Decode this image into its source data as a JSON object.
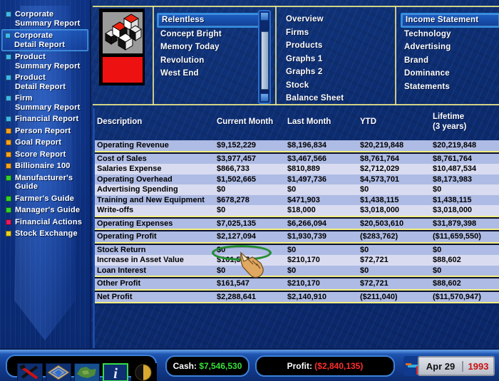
{
  "sidebar": {
    "items": [
      {
        "label": [
          "Corporate",
          "Summary Report"
        ],
        "color": "#3fb6ea",
        "selected": false
      },
      {
        "label": [
          "Corporate",
          "Detail Report"
        ],
        "color": "#3fb6ea",
        "selected": true
      },
      {
        "label": [
          "Product",
          "Summary Report"
        ],
        "color": "#3fb6ea",
        "selected": false
      },
      {
        "label": [
          "Product",
          "Detail Report"
        ],
        "color": "#3fb6ea",
        "selected": false
      },
      {
        "label": [
          "Firm",
          "Summary Report"
        ],
        "color": "#3fb6ea",
        "selected": false
      },
      {
        "label": [
          "Financial Report"
        ],
        "color": "#3fb6ea",
        "selected": false
      },
      {
        "label": [
          "Person Report"
        ],
        "color": "#f5a21e",
        "selected": false
      },
      {
        "label": [
          "Goal Report"
        ],
        "color": "#f5a21e",
        "selected": false
      },
      {
        "label": [
          "Score Report"
        ],
        "color": "#f5a21e",
        "selected": false
      },
      {
        "label": [
          "Billionaire 100"
        ],
        "color": "#f5a21e",
        "selected": false
      },
      {
        "label": [
          "Manufacturer's",
          "Guide"
        ],
        "color": "#34d12a",
        "selected": false
      },
      {
        "label": [
          "Farmer's Guide"
        ],
        "color": "#34d12a",
        "selected": false
      },
      {
        "label": [
          "Manager's Guide"
        ],
        "color": "#34d12a",
        "selected": false
      },
      {
        "label": [
          "Financial Actions"
        ],
        "color": "#e81a5e",
        "selected": false
      },
      {
        "label": [
          "Stock Exchange"
        ],
        "color": "#e8d21e",
        "selected": false
      }
    ]
  },
  "logo": {
    "name": "company-logo"
  },
  "firm_list": {
    "items": [
      {
        "label": "Relentless",
        "selected": true
      },
      {
        "label": "Concept Bright",
        "selected": false
      },
      {
        "label": "Memory Today",
        "selected": false
      },
      {
        "label": "Revolution",
        "selected": false
      },
      {
        "label": "West End",
        "selected": false
      }
    ]
  },
  "section_menu": {
    "items": [
      {
        "label": "Overview",
        "selected": false
      },
      {
        "label": "Firms",
        "selected": false
      },
      {
        "label": "Products",
        "selected": false
      },
      {
        "label": "Graphs 1",
        "selected": false
      },
      {
        "label": "Graphs 2",
        "selected": false
      },
      {
        "label": "Stock",
        "selected": false
      },
      {
        "label": "Balance Sheet",
        "selected": false
      }
    ]
  },
  "detail_menu": {
    "items": [
      {
        "label": "Income Statement",
        "selected": true
      },
      {
        "label": "Technology",
        "selected": false
      },
      {
        "label": "Advertising",
        "selected": false
      },
      {
        "label": "Brand",
        "selected": false
      },
      {
        "label": "Dominance",
        "selected": false
      },
      {
        "label": "Statements",
        "selected": false
      }
    ]
  },
  "table": {
    "headers": [
      "Description",
      "Current Month",
      "Last Month",
      "YTD",
      "Lifetime"
    ],
    "header_sub": "(3 years)",
    "groups": [
      {
        "rows": [
          {
            "desc": "Operating Revenue",
            "current": "$9,152,229",
            "last": "$8,196,834",
            "ytd": "$20,219,848",
            "lifetime": "$20,219,848"
          }
        ]
      },
      {
        "rows": [
          {
            "desc": "Cost of Sales",
            "current": "$3,977,457",
            "last": "$3,467,566",
            "ytd": "$8,761,764",
            "lifetime": "$8,761,764"
          },
          {
            "desc": "Salaries Expense",
            "current": "$866,733",
            "last": "$810,889",
            "ytd": "$2,712,029",
            "lifetime": "$10,487,534"
          },
          {
            "desc": "Operating Overhead",
            "current": "$1,502,665",
            "last": "$1,497,736",
            "ytd": "$4,573,701",
            "lifetime": "$8,173,983"
          },
          {
            "desc": "Advertising Spending",
            "current": "$0",
            "last": "$0",
            "ytd": "$0",
            "lifetime": "$0"
          },
          {
            "desc": "Training and New Equipment",
            "current": "$678,278",
            "last": "$471,903",
            "ytd": "$1,438,115",
            "lifetime": "$1,438,115"
          },
          {
            "desc": "Write-offs",
            "current": "$0",
            "last": "$18,000",
            "ytd": "$3,018,000",
            "lifetime": "$3,018,000"
          }
        ]
      },
      {
        "rows": [
          {
            "desc": "Operating Expenses",
            "current": "$7,025,135",
            "last": "$6,266,094",
            "ytd": "$20,503,610",
            "lifetime": "$31,879,398"
          }
        ]
      },
      {
        "rows": [
          {
            "desc": "Operating Profit",
            "current": "$2,127,094",
            "last": "$1,930,739",
            "ytd": "($283,762)",
            "lifetime": "($11,659,550)"
          }
        ]
      },
      {
        "rows": [
          {
            "desc": "Stock Return",
            "current": "$0",
            "last": "$0",
            "ytd": "$0",
            "lifetime": "$0"
          },
          {
            "desc": "Increase in Asset Value",
            "current": "$161,547",
            "last": "$210,170",
            "ytd": "$72,721",
            "lifetime": "$88,602"
          },
          {
            "desc": "Loan Interest",
            "current": "$0",
            "last": "$0",
            "ytd": "$0",
            "lifetime": "$0"
          }
        ]
      },
      {
        "rows": [
          {
            "desc": "Other Profit",
            "current": "$161,547",
            "last": "$210,170",
            "ytd": "$72,721",
            "lifetime": "$88,602"
          }
        ]
      },
      {
        "rows": [
          {
            "desc": "Net Profit",
            "current": "$2,288,641",
            "last": "$2,140,910",
            "ytd": "($211,040)",
            "lifetime": "($11,570,947)"
          }
        ]
      }
    ]
  },
  "annotation": {
    "highlight_color": "#1f8f2e",
    "highlight_target": "$2,127,094"
  },
  "statusbar": {
    "tools": [
      {
        "name": "tools-icon",
        "selected": false
      },
      {
        "name": "city-grid-icon",
        "selected": false
      },
      {
        "name": "world-map-icon",
        "selected": false
      },
      {
        "name": "info-icon",
        "selected": true
      },
      {
        "name": "compass-icon",
        "selected": false
      }
    ],
    "cash_label": "Cash:",
    "cash_value": "$7,546,530",
    "cash_color": "#35e03a",
    "profit_label": "Profit:",
    "profit_value": "($2,840,135)",
    "profit_color": "#ff2d2d",
    "speed_icon": "speed-control-icon",
    "date": "Apr  29",
    "year": "1993"
  }
}
